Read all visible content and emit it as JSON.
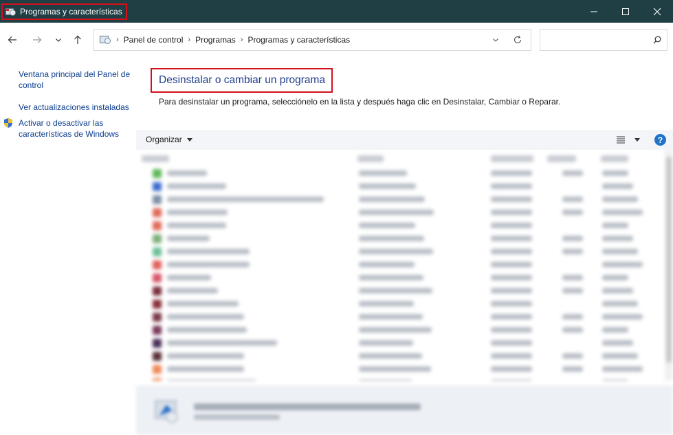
{
  "window": {
    "title": "Programas y características"
  },
  "address_bar": {
    "breadcrumbs": [
      "Panel de control",
      "Programas",
      "Programas y características"
    ],
    "search_placeholder": ""
  },
  "left_pane": {
    "links": [
      "Ventana principal del Panel de control",
      "Ver actualizaciones instaladas",
      "Activar o desactivar las características de Windows"
    ]
  },
  "main": {
    "heading": "Desinstalar o cambiar un programa",
    "instructions": "Para desinstalar un programa, selecciónelo en la lista y después haga clic en Desinstalar, Cambiar o Reparar.",
    "toolbar": {
      "organize_label": "Organizar",
      "help_label": "?"
    }
  },
  "colors": {
    "titlebar": "#1f3f45",
    "highlight": "#d4101b",
    "link": "#0b3d8c",
    "heading": "#1e3c8c"
  },
  "icons": [
    "control-panel-icon",
    "minimize-icon",
    "maximize-icon",
    "close-icon",
    "back-arrow-icon",
    "forward-arrow-icon",
    "recent-chevron-icon",
    "up-arrow-icon",
    "chevron-down-icon",
    "refresh-icon",
    "search-icon",
    "shield-icon",
    "view-list-icon",
    "help-icon"
  ]
}
